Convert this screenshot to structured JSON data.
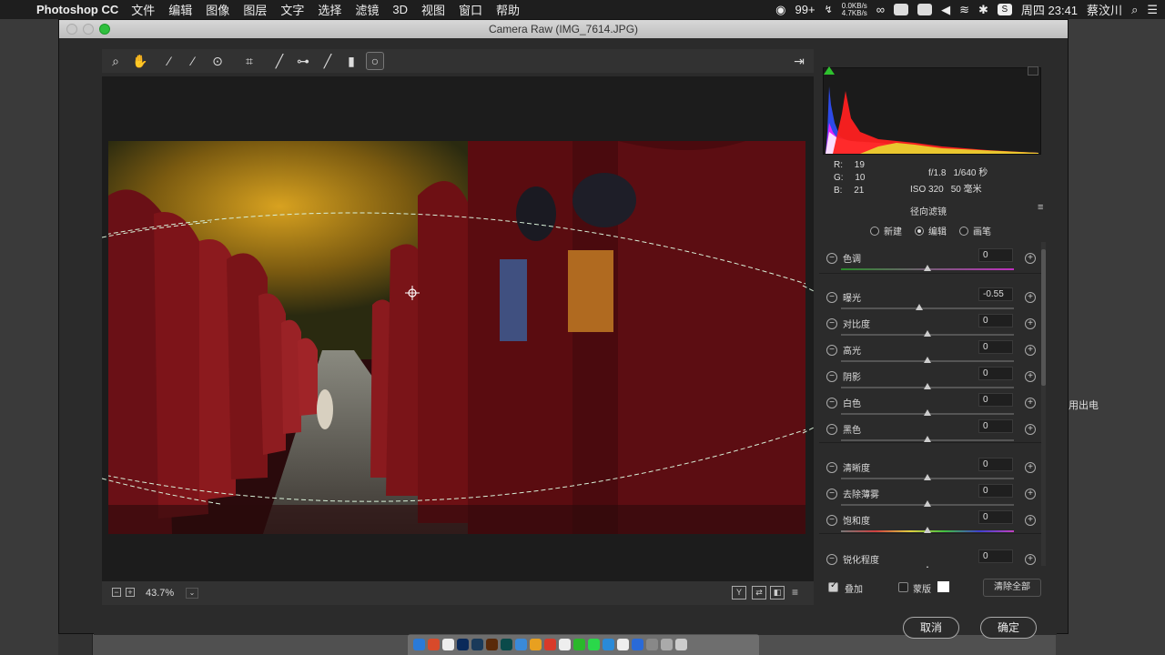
{
  "menubar": {
    "app_name": "Photoshop CC",
    "items": [
      "文件",
      "编辑",
      "图像",
      "图层",
      "文字",
      "选择",
      "滤镜",
      "3D",
      "视图",
      "窗口",
      "帮助"
    ],
    "wechat_badge": "99+",
    "net_up": "0.0KB/s",
    "net_down": "4.7KB/s",
    "clock": "周四 23:41",
    "user": "蔡汶川"
  },
  "window": {
    "title": "Camera Raw (IMG_7614.JPG)"
  },
  "top_tools": [
    "zoom-icon",
    "hand-icon",
    "white-balance-icon",
    "color-sampler-icon",
    "target-adjust-icon",
    "crop-straighten-icon",
    "spot-removal-icon",
    "red-eye-icon",
    "adjustment-brush-icon",
    "graduated-filter-icon",
    "radial-filter-icon"
  ],
  "info": {
    "r_label": "R:",
    "r": "19",
    "g_label": "G:",
    "g": "10",
    "b_label": "B:",
    "b": "21",
    "aperture": "f/1.8",
    "shutter": "1/640 秒",
    "iso": "ISO 320",
    "focal": "50 毫米"
  },
  "panel": {
    "title": "径向滤镜",
    "modes": [
      {
        "label": "新建",
        "selected": false
      },
      {
        "label": "编辑",
        "selected": true
      },
      {
        "label": "画笔",
        "selected": false
      }
    ],
    "sliders": [
      {
        "label": "色调",
        "value": "0",
        "pos": 0.5
      },
      {
        "label": "曝光",
        "value": "-0.55",
        "pos": 0.45
      },
      {
        "label": "对比度",
        "value": "0",
        "pos": 0.5
      },
      {
        "label": "高光",
        "value": "0",
        "pos": 0.5
      },
      {
        "label": "阴影",
        "value": "0",
        "pos": 0.5
      },
      {
        "label": "白色",
        "value": "0",
        "pos": 0.5
      },
      {
        "label": "黑色",
        "value": "0",
        "pos": 0.5
      },
      {
        "label": "清晰度",
        "value": "0",
        "pos": 0.5
      },
      {
        "label": "去除薄雾",
        "value": "0",
        "pos": 0.5
      },
      {
        "label": "饱和度",
        "value": "0",
        "pos": 0.5
      },
      {
        "label": "锐化程度",
        "value": "0",
        "pos": 0.5
      }
    ],
    "overlay_label": "叠加",
    "mask_label": "蒙版",
    "clear_all": "清除全部"
  },
  "zoom_level": "43.7%",
  "buttons": {
    "cancel": "取消",
    "ok": "确定"
  },
  "right_gutter_text": "用出电"
}
